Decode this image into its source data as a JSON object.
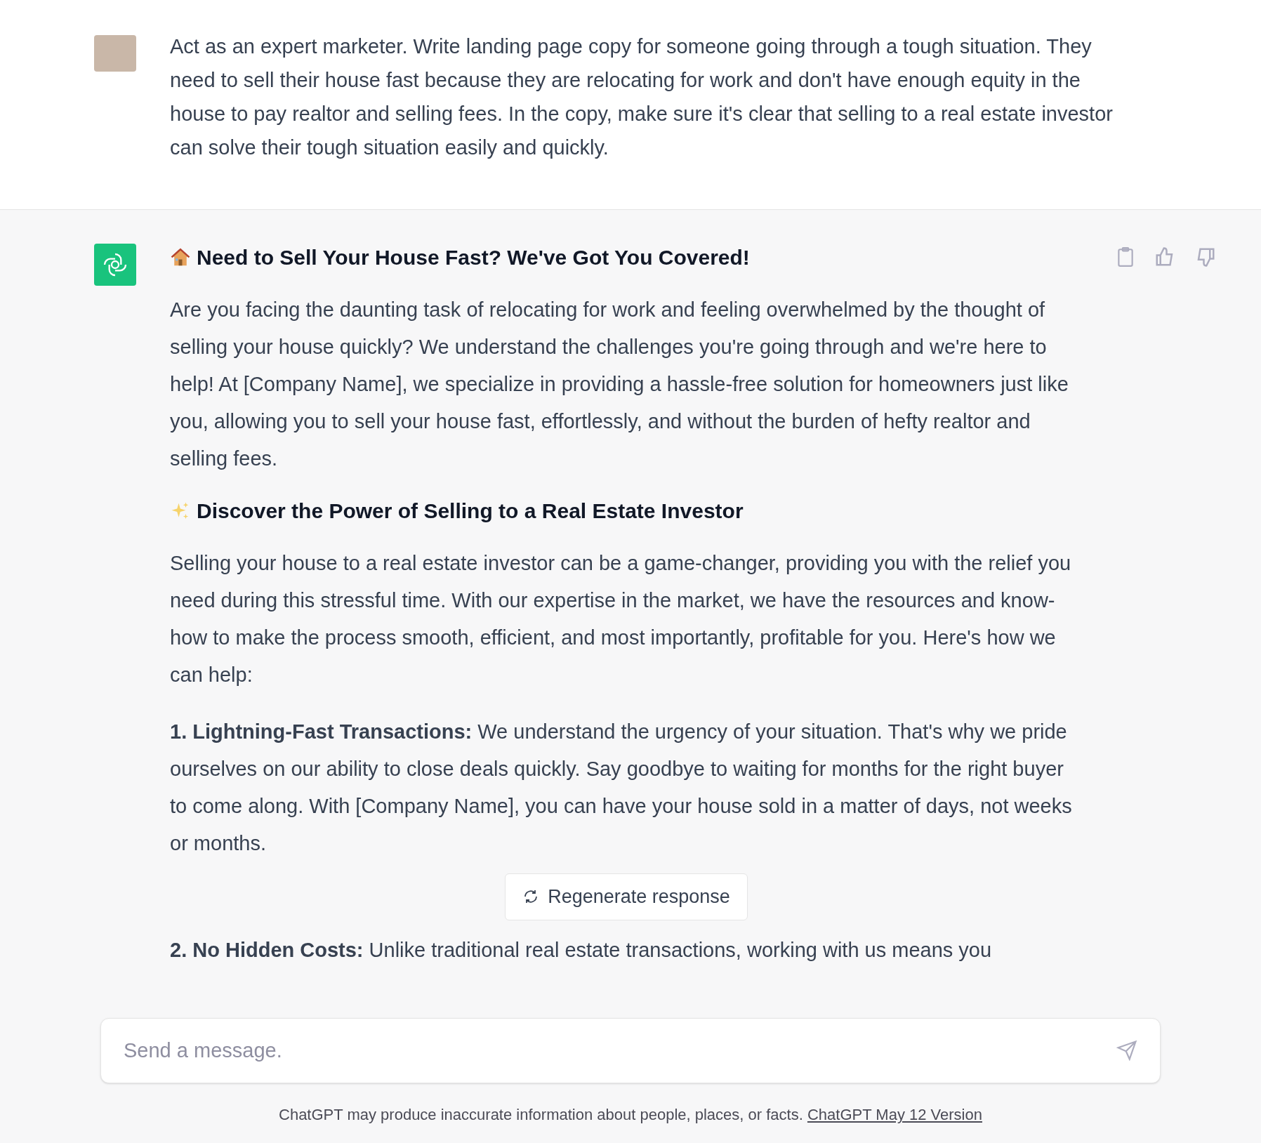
{
  "user_message": {
    "text": "Act as an expert marketer. Write landing page copy for someone going through a tough situation. They need to sell their house fast because they are relocating for work and don't have enough equity in the house to pay realtor and selling fees. In the copy, make sure it's clear that selling to a real estate investor can solve their tough situation easily and quickly."
  },
  "assistant_message": {
    "blocks": [
      {
        "kind": "heading",
        "text": "Need to Sell Your House Fast? We've Got You Covered!"
      },
      {
        "kind": "paragraph",
        "text": "Are you facing the daunting task of relocating for work and feeling overwhelmed by the thought of selling your house quickly? We understand the challenges you're going through and we're here to help! At [Company Name], we specialize in providing a hassle-free solution for homeowners just like you, allowing you to sell your house fast, effortlessly, and without the burden of hefty realtor and selling fees."
      },
      {
        "kind": "heading",
        "text": "Discover the Power of Selling to a Real Estate Investor"
      },
      {
        "kind": "paragraph",
        "text": "Selling your house to a real estate investor can be a game-changer, providing you with the relief you need during this stressful time. With our expertise in the market, we have the resources and know-how to make the process smooth, efficient, and most importantly, profitable for you. Here's how we can help:"
      },
      {
        "kind": "paragraph",
        "text": "**1. Lightning-Fast Transactions:** We understand the urgency of your situation. That's why we pride ourselves on our ability to close deals quickly. Say goodbye to waiting for months for the right buyer to come along. With [Company Name], you can have your house sold in a matter of days, not weeks or months."
      },
      {
        "kind": "paragraph",
        "text": "**2. No Hidden Costs:** Unlike traditional real estate transactions, working with us means you"
      }
    ]
  },
  "regenerate_button": "Regenerate response",
  "composer": {
    "placeholder": "Send a message."
  },
  "footer": {
    "text": "ChatGPT may produce inaccurate information about people, places, or facts.",
    "link": "ChatGPT May 12 Version"
  }
}
